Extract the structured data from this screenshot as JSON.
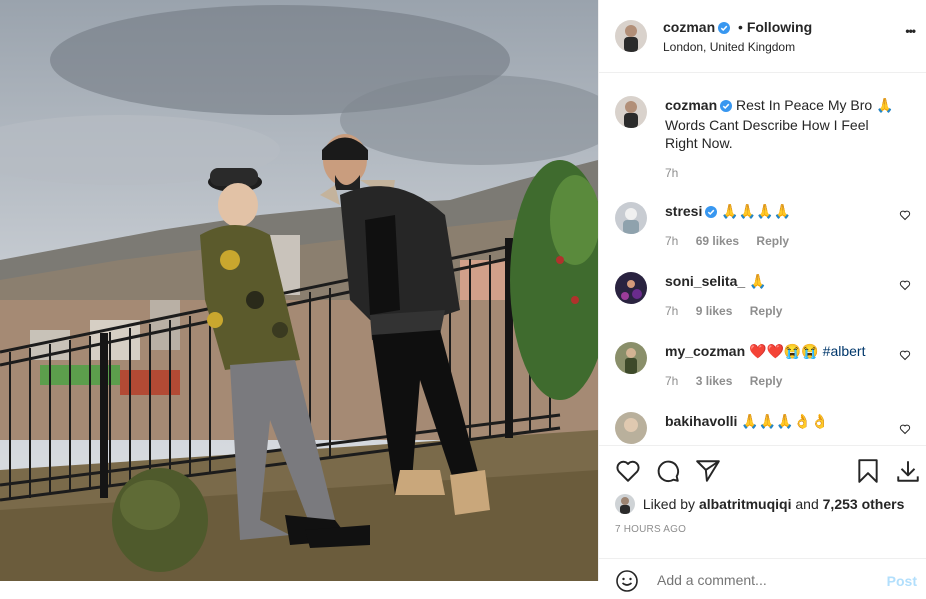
{
  "post": {
    "username": "cozman",
    "follow_sep": "•",
    "follow_label": "Following",
    "location": "London, United Kingdom",
    "more_label": "•••"
  },
  "caption": {
    "username": "cozman",
    "text": "Rest In Peace My Bro 🙏 Words Cant Describe How I Feel Right Now.",
    "time": "7h"
  },
  "comments": [
    {
      "username": "stresi",
      "verified": true,
      "text": "🙏🙏🙏🙏",
      "tag": "",
      "time": "7h",
      "likes": "69 likes",
      "reply": "Reply"
    },
    {
      "username": "soni_selita_",
      "verified": false,
      "text": "🙏",
      "tag": "",
      "time": "7h",
      "likes": "9 likes",
      "reply": "Reply"
    },
    {
      "username": "my_cozman",
      "verified": false,
      "text": "❤️❤️😭😭",
      "tag": "#albert",
      "time": "7h",
      "likes": "3 likes",
      "reply": "Reply"
    },
    {
      "username": "bakihavolli",
      "verified": false,
      "text": "🙏🙏🙏👌👌",
      "tag": "",
      "time": "",
      "likes": "",
      "reply": ""
    }
  ],
  "likes": {
    "prefix": "Liked by",
    "user": "albatritmuqiqi",
    "conj": "and",
    "others": "7,253 others"
  },
  "timestamp": "7 HOURS AGO",
  "add_comment": {
    "placeholder": "Add a comment...",
    "post_label": "Post"
  },
  "colors": {
    "verified": "#3897f0",
    "link": "#00376b",
    "post_disabled": "#b2dffc",
    "muted": "#8e8e8e"
  }
}
